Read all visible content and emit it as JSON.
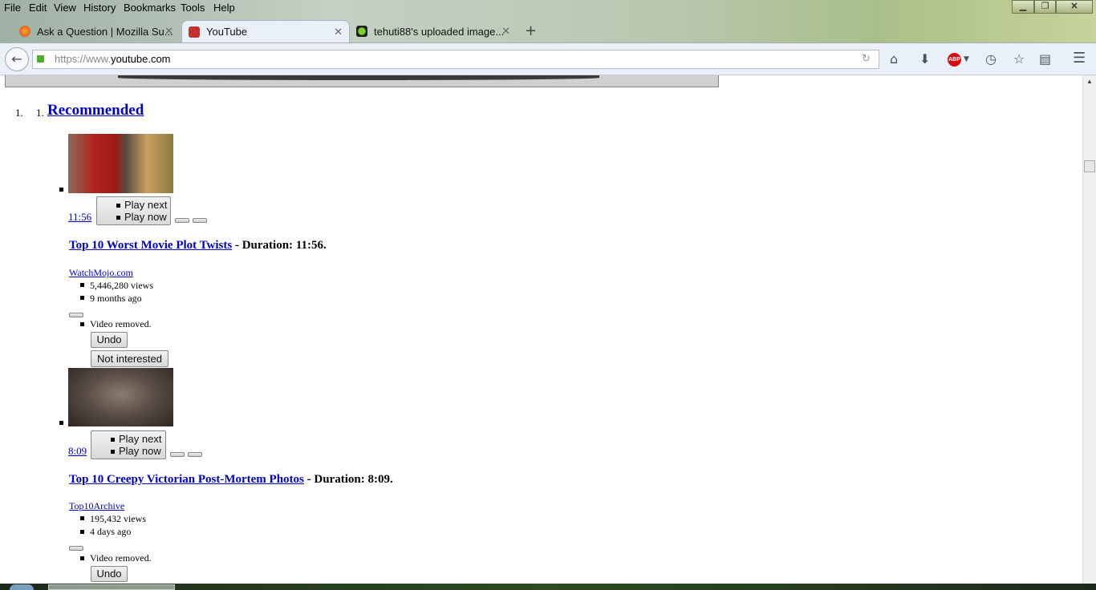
{
  "menu": [
    "File",
    "Edit",
    "View",
    "History",
    "Bookmarks",
    "Tools",
    "Help"
  ],
  "tabs": [
    {
      "label": "Ask a Question | Mozilla Su...",
      "icon": "firefox-icon"
    },
    {
      "label": "YouTube",
      "icon": "youtube-icon",
      "active": true
    },
    {
      "label": "tehuti88's uploaded image...",
      "icon": "green-dot-icon"
    }
  ],
  "url": {
    "prefix": "https://www.",
    "domain": "youtube.com"
  },
  "toolbar": {
    "abp": "ABP"
  },
  "content": {
    "outer_num": "1.",
    "inner_num": "1.",
    "section": "Recommended",
    "videos": [
      {
        "duration": "11:56",
        "play_next": "Play next",
        "play_now": "Play now",
        "title": "Top 10 Worst Movie Plot Twists",
        "duration_text": "- Duration: 11:56.",
        "channel": "WatchMojo.com",
        "views": "5,446,280 views",
        "age": "9 months ago",
        "removed": "Video removed.",
        "undo": "Undo",
        "not_interested": "Not interested",
        "thumb_colors": [
          "#b2231c",
          "#6a5a48",
          "#c9a060"
        ]
      },
      {
        "duration": "8:09",
        "play_next": "Play next",
        "play_now": "Play now",
        "title": "Top 10 Creepy Victorian Post-Mortem Photos",
        "duration_text": "- Duration: 8:09.",
        "channel": "Top10Archive",
        "views": "195,432 views",
        "age": "4 days ago",
        "removed": "Video removed.",
        "undo": "Undo",
        "thumb_colors": [
          "#4a403a",
          "#8a7c70",
          "#2a2420"
        ]
      }
    ]
  }
}
